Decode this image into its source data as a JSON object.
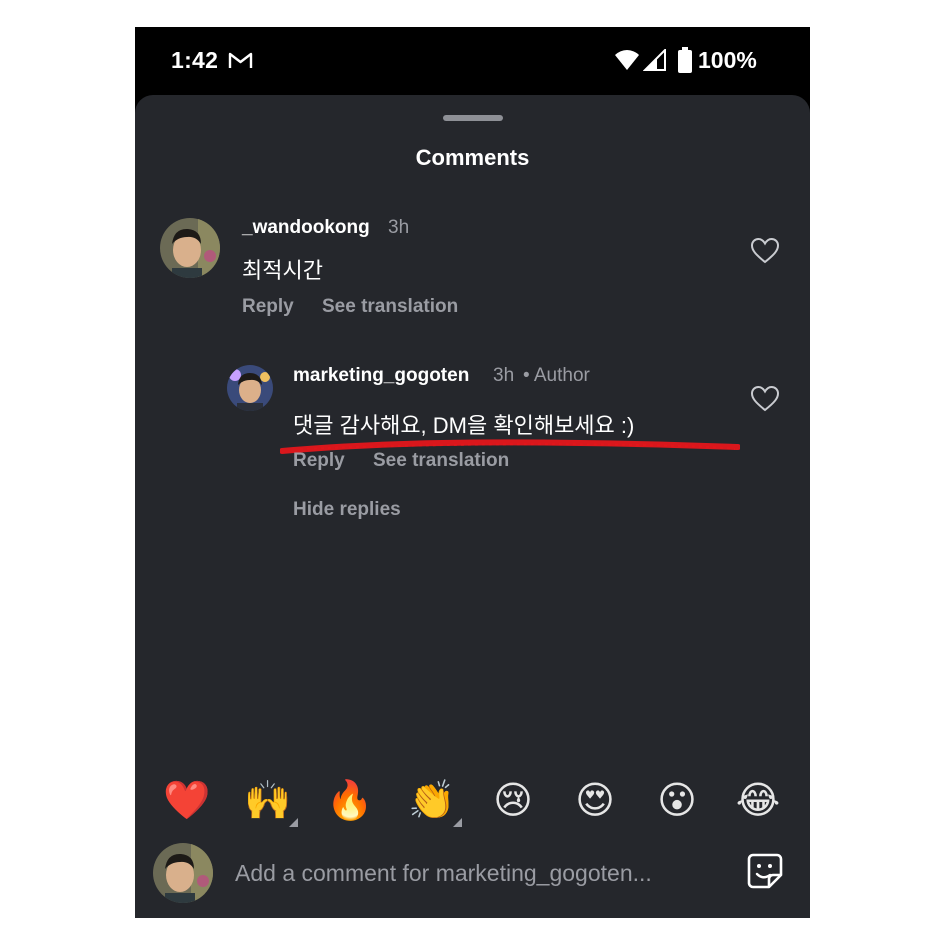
{
  "status_bar": {
    "time": "1:42",
    "battery": "100%"
  },
  "sheet": {
    "title": "Comments"
  },
  "comments": [
    {
      "username": "_wandookong",
      "time": "3h",
      "text": "최적시간",
      "reply_label": "Reply",
      "translate_label": "See translation"
    }
  ],
  "reply": {
    "username": "marketing_gogoten",
    "time": "3h",
    "badge": "• Author",
    "text": "댓글 감사해요, DM을 확인해보세요 :)",
    "reply_label": "Reply",
    "translate_label": "See translation",
    "hide_label": "Hide replies"
  },
  "emoji_bar": [
    {
      "glyph": "❤️",
      "name": "red-heart"
    },
    {
      "glyph": "🙌",
      "name": "raising-hands"
    },
    {
      "glyph": "🔥",
      "name": "fire"
    },
    {
      "glyph": "👏",
      "name": "clapping-hands"
    },
    {
      "glyph": "😢",
      "name": "crying-face"
    },
    {
      "glyph": "😍",
      "name": "heart-eyes"
    },
    {
      "glyph": "😮",
      "name": "open-mouth"
    },
    {
      "glyph": "😂",
      "name": "tears-of-joy"
    }
  ],
  "input": {
    "placeholder": "Add a comment for marketing_gogoten..."
  },
  "colors": {
    "sheet_bg": "#25272c",
    "muted_text": "#9a9ca3",
    "annotation_red": "#e3161b"
  }
}
